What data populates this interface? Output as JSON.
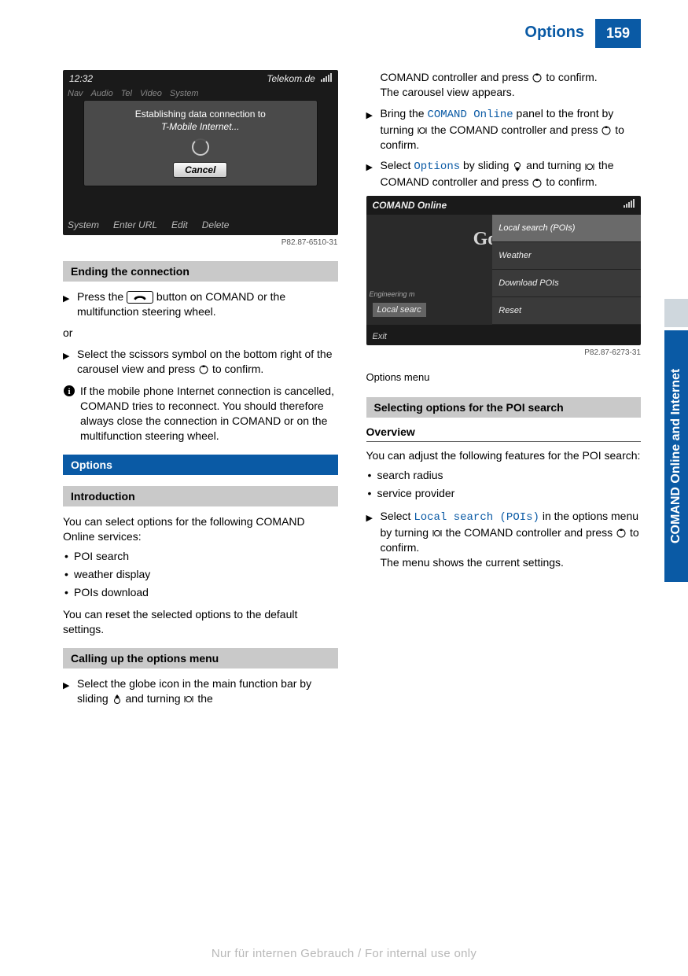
{
  "header": {
    "title": "Options",
    "page_number": "159"
  },
  "side_tab": "COMAND Online and Internet",
  "watermark": "Nur für internen Gebrauch / For internal use only",
  "fig1": {
    "status_time": "12:32",
    "status_carrier": "Telekom.de",
    "menubar": [
      "Nav",
      "Audio",
      "Tel",
      "Video",
      "System"
    ],
    "dialog_line1": "Establishing data connection to",
    "dialog_line2": "T-Mobile Internet...",
    "cancel": "Cancel",
    "bottombar": [
      "System",
      "Enter URL",
      "Edit",
      "Delete"
    ],
    "ref": "P82.87-6510-31"
  },
  "left": {
    "h_ending": "Ending the connection",
    "step1_a": "Press the ",
    "step1_b": " button on COMAND or the multifunction steering wheel.",
    "or": "or",
    "step2": "Select the scissors symbol on the bottom right of the carousel view and press ",
    "step2_b": " to confirm.",
    "info": "If the mobile phone Internet connection is cancelled, COMAND tries to reconnect. You should therefore always close the connection in COMAND or on the multifunction steering wheel.",
    "h_options": "Options",
    "h_intro": "Introduction",
    "intro_p": "You can select options for the following COMAND Online services:",
    "intro_items": [
      "POI search",
      "weather display",
      "POIs download"
    ],
    "intro_p2": "You can reset the selected options to the default settings.",
    "h_calling": "Calling up the options menu",
    "calling_step_a": "Select the globe icon in the main function bar by sliding ",
    "calling_step_b": " and turning ",
    "calling_step_c": " the"
  },
  "right": {
    "cont_a": "COMAND controller and press ",
    "cont_b": " to confirm.",
    "cont_c": "The carousel view appears.",
    "step2_a": "Bring the ",
    "step2_code": "COMAND Online",
    "step2_b": " panel to the front by turning ",
    "step2_c": " the COMAND controller and press ",
    "step2_d": " to confirm.",
    "step3_a": "Select ",
    "step3_code": "Options",
    "step3_b": " by sliding ",
    "step3_c": " and turning ",
    "step3_d": " the COMAND controller and press ",
    "step3_e": " to confirm.",
    "fig2": {
      "title": "COMAND Online",
      "left_label_small": "Engineering m",
      "left_label": "Local searc",
      "items": [
        "Local search (POIs)",
        "Weather",
        "Download POIs",
        "Reset"
      ],
      "exit": "Exit",
      "ref": "P82.87-6273-31",
      "caption": "Options menu"
    },
    "h_selecting": "Selecting options for the POI search",
    "sub_overview": "Overview",
    "overview_p": "You can adjust the following features for the POI search:",
    "overview_items": [
      "search radius",
      "service provider"
    ],
    "ov_step_a": "Select ",
    "ov_step_code": "Local search (POIs)",
    "ov_step_b": " in the options menu by turning ",
    "ov_step_c": " the COMAND controller and press ",
    "ov_step_d": " to confirm.",
    "ov_step_e": "The menu shows the current settings."
  }
}
